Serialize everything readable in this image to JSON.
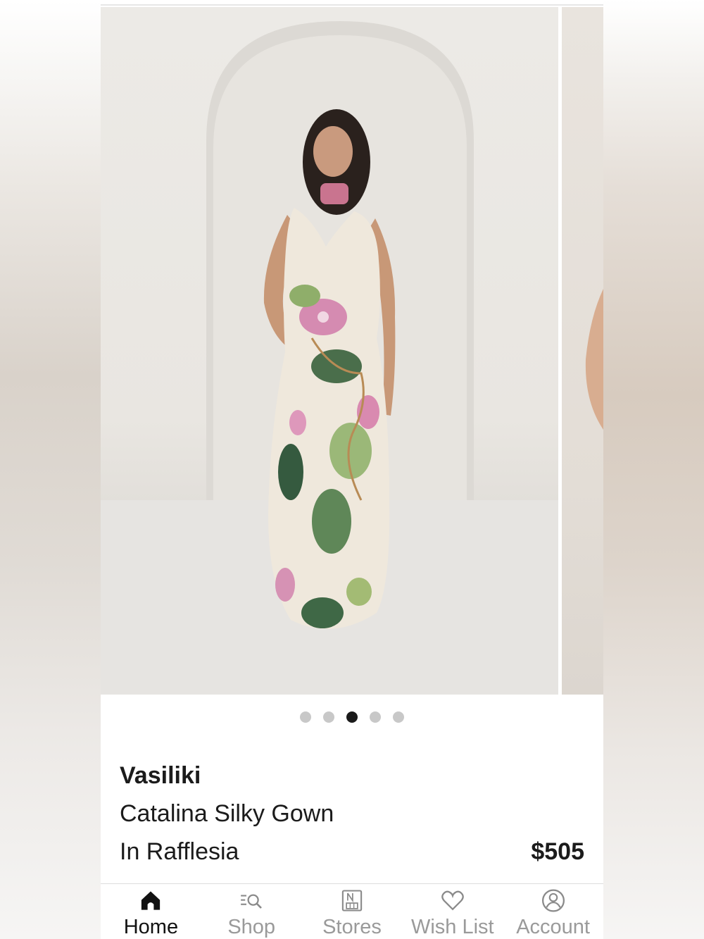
{
  "carousel": {
    "dot_count": 5,
    "active_index": 2
  },
  "product": {
    "brand": "Vasiliki",
    "name_line1": "Catalina Silky Gown",
    "name_line2": "In Rafflesia",
    "price": "$505"
  },
  "nav": {
    "items": [
      {
        "label": "Home",
        "icon": "home-icon",
        "active": true
      },
      {
        "label": "Shop",
        "icon": "shop-search-icon",
        "active": false
      },
      {
        "label": "Stores",
        "icon": "stores-icon",
        "active": false
      },
      {
        "label": "Wish List",
        "icon": "heart-icon",
        "active": false
      },
      {
        "label": "Account",
        "icon": "account-icon",
        "active": false
      }
    ]
  },
  "colors": {
    "active": "#111111",
    "inactive": "#9a9a9a",
    "dot_inactive": "#c8c8c8"
  }
}
